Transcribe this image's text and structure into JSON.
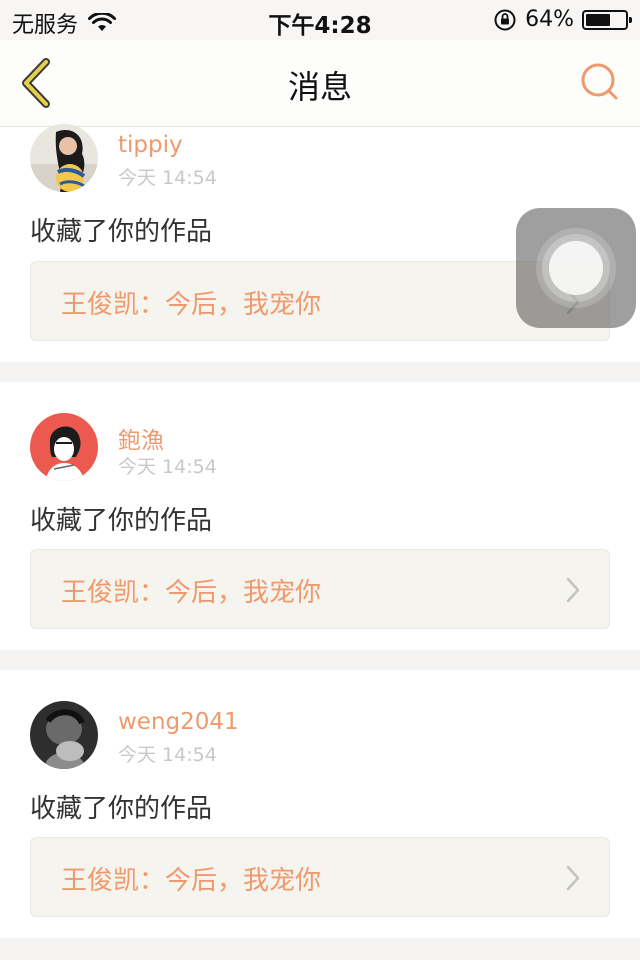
{
  "status_bar": {
    "carrier": "无服务",
    "wifi_icon": "wifi-icon",
    "time": "下午4:28",
    "orientation_lock_icon": "orientation-lock-icon",
    "battery_percent": "64%",
    "battery_level": 0.64
  },
  "nav": {
    "back_icon": "chevron-left-icon",
    "title": "消息",
    "search_icon": "search-icon",
    "accent_color": "#ee9a6d",
    "back_color": "#e6d04a"
  },
  "messages": [
    {
      "username": "tippiy",
      "time": "今天 14:54",
      "action": "收藏了你的作品",
      "work_title": "王俊凯：今后，我宠你",
      "avatar": "avatar-photo"
    },
    {
      "username": "鉋漁",
      "time": "今天 14:54",
      "action": "收藏了你的作品",
      "work_title": "王俊凯：今后，我宠你",
      "avatar": "avatar-illustration"
    },
    {
      "username": "weng2041",
      "time": "今天 14:54",
      "action": "收藏了你的作品",
      "work_title": "王俊凯：今后，我宠你",
      "avatar": "avatar-photo-dark"
    }
  ],
  "assistive_touch": {
    "icon": "assistive-touch-icon"
  }
}
